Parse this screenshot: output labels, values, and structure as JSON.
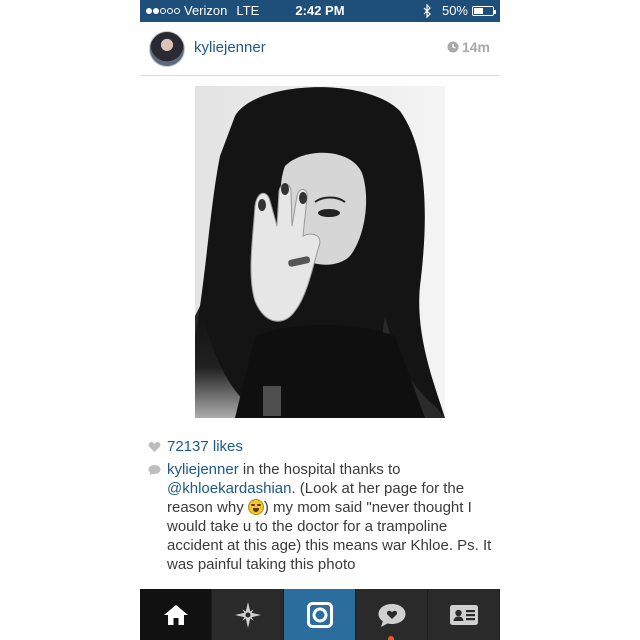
{
  "status_bar": {
    "signal_dots": {
      "filled": 2,
      "total": 5
    },
    "carrier": "Verizon",
    "network": "LTE",
    "time": "2:42 PM",
    "battery_percent": "50%",
    "battery_level": 0.5
  },
  "post": {
    "username": "kyliejenner",
    "time_ago": "14m",
    "likes": "72137 likes",
    "caption": {
      "user": "kyliejenner",
      "text_before_mention": " in the hospital thanks to ",
      "mention": "@khloekardashian",
      "text_before_emoji": ". (Look at her page for the reason why ",
      "emoji": "joy-emoji",
      "text_after_emoji": ") my mom said \"never thought I would take u to the doctor for a trampoline accident at this age) this means war Khloe. Ps. It was painful taking this photo"
    }
  },
  "tab_bar": {
    "tabs": [
      {
        "name": "home",
        "icon": "home-icon",
        "active": true
      },
      {
        "name": "explore",
        "icon": "star-compass-icon"
      },
      {
        "name": "camera",
        "icon": "camera-icon",
        "highlighted": true
      },
      {
        "name": "activity",
        "icon": "heart-bubble-icon"
      },
      {
        "name": "profile",
        "icon": "profile-card-icon"
      }
    ]
  },
  "colors": {
    "status_bar_bg": "#1d4f7a",
    "link_blue": "#1d5a8a",
    "tab_bar_bg": "#2a2a2a",
    "camera_tab_bg": "#2b6e9e",
    "notification": "#e8572a"
  }
}
